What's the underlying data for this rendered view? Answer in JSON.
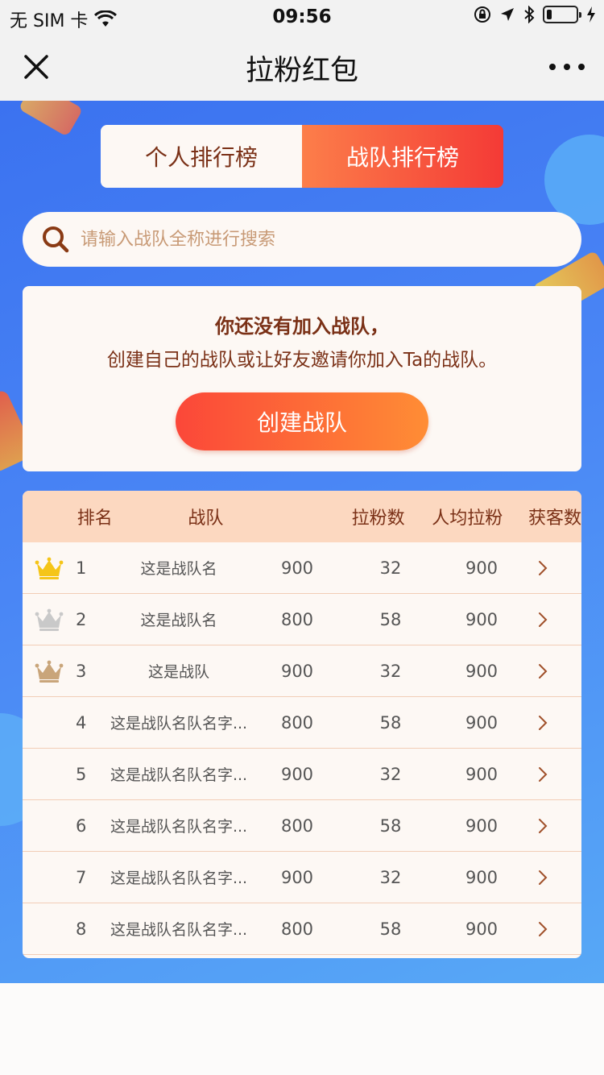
{
  "status_bar": {
    "carrier": "无 SIM 卡",
    "time": "09:56"
  },
  "nav": {
    "title": "拉粉红包",
    "close_icon": "close-icon",
    "more_icon": "more-dots-icon"
  },
  "tabs": [
    {
      "label": "个人排行榜",
      "active": false
    },
    {
      "label": "战队排行榜",
      "active": true
    }
  ],
  "search": {
    "placeholder": "请输入战队全称进行搜索"
  },
  "notice": {
    "title": "你还没有加入战队，",
    "subtitle": "创建自己的战队或让好友邀请你加入Ta的战队。",
    "button_label": "创建战队"
  },
  "table": {
    "headers": {
      "rank": "排名",
      "team": "战队",
      "fans": "拉粉数",
      "avg": "人均拉粉",
      "customers": "获客数"
    },
    "rows": [
      {
        "rank": "1",
        "team": "这是战队名",
        "fans": "900",
        "avg": "32",
        "customers": "900",
        "crown": "gold"
      },
      {
        "rank": "2",
        "team": "这是战队名",
        "fans": "800",
        "avg": "58",
        "customers": "900",
        "crown": "silver"
      },
      {
        "rank": "3",
        "team": "这是战队",
        "fans": "900",
        "avg": "32",
        "customers": "900",
        "crown": "bronze"
      },
      {
        "rank": "4",
        "team": "这是战队名队名字...",
        "fans": "800",
        "avg": "58",
        "customers": "900",
        "crown": ""
      },
      {
        "rank": "5",
        "team": "这是战队名队名字...",
        "fans": "900",
        "avg": "32",
        "customers": "900",
        "crown": ""
      },
      {
        "rank": "6",
        "team": "这是战队名队名字...",
        "fans": "800",
        "avg": "58",
        "customers": "900",
        "crown": ""
      },
      {
        "rank": "7",
        "team": "这是战队名队名字...",
        "fans": "900",
        "avg": "32",
        "customers": "900",
        "crown": ""
      },
      {
        "rank": "8",
        "team": "这是战队名队名字...",
        "fans": "800",
        "avg": "58",
        "customers": "900",
        "crown": ""
      }
    ]
  },
  "colors": {
    "accent_orange": "#fc7e4a",
    "accent_red": "#f43a36",
    "text_brown": "#7a3016",
    "header_bg": "#fcd8c0",
    "gold": "#f5c518",
    "silver": "#c9c9c9",
    "bronze": "#c9a57a"
  }
}
